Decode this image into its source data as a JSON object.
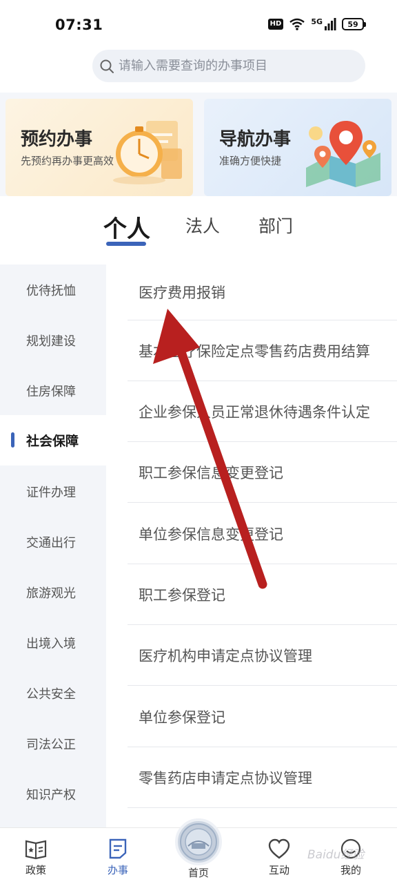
{
  "status_bar": {
    "time": "07:31",
    "hd": "HD",
    "network": "5G",
    "battery": "59"
  },
  "search": {
    "placeholder": "请输入需要查询的办事项目"
  },
  "banners": [
    {
      "title": "预约办事",
      "subtitle": "先预约再办事更高效"
    },
    {
      "title": "导航办事",
      "subtitle": "准确方便快捷"
    }
  ],
  "tabs": [
    {
      "label": "个人",
      "active": true
    },
    {
      "label": "法人",
      "active": false
    },
    {
      "label": "部门",
      "active": false
    }
  ],
  "sidebar": {
    "items": [
      {
        "label": "优待抚恤"
      },
      {
        "label": "规划建设"
      },
      {
        "label": "住房保障"
      },
      {
        "label": "社会保障",
        "active": true
      },
      {
        "label": "证件办理"
      },
      {
        "label": "交通出行"
      },
      {
        "label": "旅游观光"
      },
      {
        "label": "出境入境"
      },
      {
        "label": "公共安全"
      },
      {
        "label": "司法公正"
      },
      {
        "label": "知识产权"
      }
    ]
  },
  "services": [
    "医疗费用报销",
    "基本医疗保险定点零售药店费用结算",
    "企业参保人员正常退休待遇条件认定",
    "职工参保信息变更登记",
    "单位参保信息变更登记",
    "职工参保登记",
    "医疗机构申请定点协议管理",
    "单位参保登记",
    "零售药店申请定点协议管理"
  ],
  "bottom_nav": {
    "policy": "政策",
    "affairs": "办事",
    "home": "首页",
    "interact": "互动",
    "mine": "我的",
    "active": "affairs"
  },
  "watermark": "Baidu经验",
  "colors": {
    "accent": "#3b64b9",
    "arrow": "#b8201f"
  }
}
